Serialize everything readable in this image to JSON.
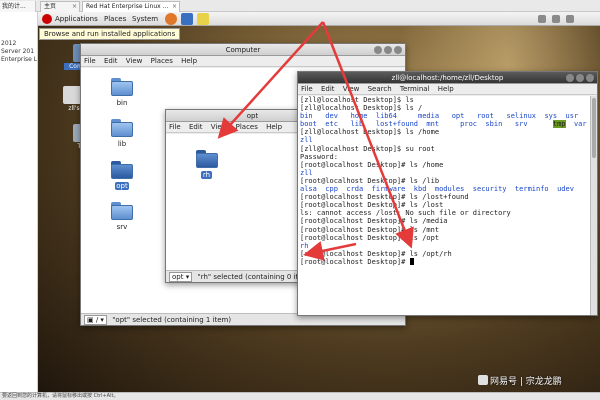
{
  "vm": {
    "left_tab_label": "我的计...",
    "tabs": [
      {
        "label": "主页"
      },
      {
        "label": "Red Hat Enterprise Linux ..."
      }
    ],
    "left_panel_lines": [
      "2012",
      "Server 201",
      "Enterprise L"
    ],
    "bottom_status": "要返回到您的计算机，请将鼠标移出或按 Ctrl+Alt。"
  },
  "panel": {
    "applications": "Applications",
    "places": "Places",
    "system": "System",
    "launchers": [
      {
        "icon": "firefox-icon",
        "color": "#e0782a"
      },
      {
        "icon": "email-icon",
        "color": "#3a70c0"
      },
      {
        "icon": "notes-icon",
        "color": "#e8d24a"
      }
    ],
    "tray_icons": [
      "network-icon",
      "volume-icon",
      "user-icon"
    ],
    "tooltip": "Browse and run installed applications"
  },
  "desktop_icons": [
    {
      "label": "Computer",
      "icon": "computer-icon",
      "color": "#6b8fb8"
    },
    {
      "label": "zll's",
      "icon": "home-folder-icon",
      "color": "#d9d9d9"
    },
    {
      "label": "Tr",
      "icon": "trash-icon",
      "color": "#9ba9b8"
    }
  ],
  "computer_window": {
    "title": "Computer",
    "menu": [
      "File",
      "Edit",
      "View",
      "Places",
      "Help"
    ],
    "folders": [
      "bin",
      "lib",
      "opt",
      "srv"
    ],
    "selected_folder": "opt",
    "path_combo": "/",
    "status_text": "\"opt\" selected (containing 1 item)"
  },
  "opt_window": {
    "title": "opt",
    "menu": [
      "File",
      "Edit",
      "View",
      "Places",
      "Help"
    ],
    "folder": "rh",
    "path_combo": "opt",
    "status_text": "\"rh\" selected (containing 0 ite"
  },
  "terminal": {
    "title": "zll@localhost:/home/zll/Desktop",
    "menu": [
      "File",
      "Edit",
      "View",
      "Search",
      "Terminal",
      "Help"
    ],
    "lines": [
      {
        "segments": [
          {
            "t": "[zll@localhost Desktop]$ ls",
            "c": ""
          }
        ]
      },
      {
        "segments": [
          {
            "t": "[zll@localhost Desktop]$ ls /",
            "c": ""
          }
        ]
      },
      {
        "segments": [
          {
            "t": "bin   dev   home  lib64     media   opt   root   selinux  ",
            "c": "c-blue"
          },
          {
            "t": "sys",
            "c": "c-blue"
          },
          {
            "t": "  usr",
            "c": "c-blue"
          }
        ]
      },
      {
        "segments": [
          {
            "t": "boot  etc   lib   lost+found  mnt     proc  sbin   srv      ",
            "c": "c-blue"
          },
          {
            "t": "tmp",
            "c": "hl"
          },
          {
            "t": "  var",
            "c": "c-blue"
          }
        ]
      },
      {
        "segments": [
          {
            "t": "[zll@localhost Desktop]$ ls /home",
            "c": ""
          }
        ]
      },
      {
        "segments": [
          {
            "t": "zll",
            "c": "c-blue"
          }
        ]
      },
      {
        "segments": [
          {
            "t": "[zll@localhost Desktop]$ su root",
            "c": ""
          }
        ]
      },
      {
        "segments": [
          {
            "t": "Password:",
            "c": ""
          }
        ]
      },
      {
        "segments": [
          {
            "t": "[root@localhost Desktop]# ls /home",
            "c": ""
          }
        ]
      },
      {
        "segments": [
          {
            "t": "zll",
            "c": "c-blue"
          }
        ]
      },
      {
        "segments": [
          {
            "t": "[root@localhost Desktop]# ls /lib",
            "c": ""
          }
        ]
      },
      {
        "segments": [
          {
            "t": "alsa  cpp  crda  firmware  kbd  modules  security  terminfo  udev",
            "c": "c-blue"
          }
        ]
      },
      {
        "segments": [
          {
            "t": "[root@localhost Desktop]# ls /lost+found",
            "c": ""
          }
        ]
      },
      {
        "segments": [
          {
            "t": "[root@localhost Desktop]# ls /lost",
            "c": ""
          }
        ]
      },
      {
        "segments": [
          {
            "t": "ls: cannot access /lost: No such file or directory",
            "c": ""
          }
        ]
      },
      {
        "segments": [
          {
            "t": "[root@localhost Desktop]# ls /media",
            "c": ""
          }
        ]
      },
      {
        "segments": [
          {
            "t": "[root@localhost Desktop]# ls /mnt",
            "c": ""
          }
        ]
      },
      {
        "segments": [
          {
            "t": "[root@localhost Desktop]# ls /opt",
            "c": ""
          }
        ]
      },
      {
        "segments": [
          {
            "t": "rh",
            "c": "c-blue"
          }
        ]
      },
      {
        "segments": [
          {
            "t": "[root@localhost Desktop]# ls /opt/rh",
            "c": ""
          }
        ]
      },
      {
        "segments": [
          {
            "t": "[root@localhost Desktop]# ",
            "c": ""
          }
        ]
      }
    ]
  },
  "watermark": {
    "brand": "网易号",
    "author": "宗龙龙鹏"
  },
  "colors": {
    "arrow": "#e53a3a",
    "selection": "#3d6fbf",
    "folder": "#5f8fd0"
  }
}
